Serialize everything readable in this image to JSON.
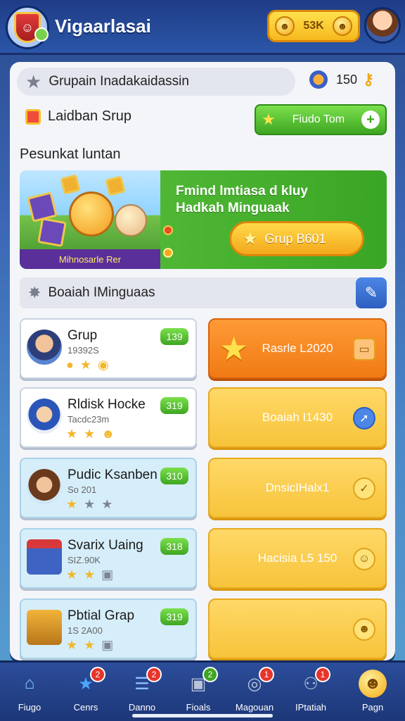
{
  "header": {
    "app_title": "Vigaarlasai",
    "currency_value": "53K"
  },
  "group": {
    "title": "Grupain Inadakaidassin",
    "rank_value": "150",
    "leaderboard_label": "Laidban Srup",
    "find_button_label": "Fiudo Tom"
  },
  "section_title": "Pesunkat luntan",
  "banner": {
    "caption": "Mihnosarle Rer",
    "text_line1": "Fmind lmtiasa d kluy",
    "text_line2": "Hadkah Minguaak",
    "button_label": "Grup B601"
  },
  "weekly": {
    "title": "Boaiah IMinguaas"
  },
  "cards": [
    {
      "name": "Grup",
      "sub": "19392S",
      "score": "139",
      "style": "white"
    },
    {
      "name": "Rldisk Hocke",
      "sub": "Tacdc23m",
      "score": "319",
      "style": "white"
    },
    {
      "name": "Pudic Ksanben",
      "sub": "So 201",
      "score": "310",
      "style": "blue"
    },
    {
      "name": "Svarix Uaing",
      "sub": "SIZ.90K",
      "score": "318",
      "style": "blue"
    },
    {
      "name": "Pbtial Grap",
      "sub": "1S 2A00",
      "score": "319",
      "style": "blue"
    }
  ],
  "rewards": [
    {
      "label": "Rasrle L2020",
      "style": "orange"
    },
    {
      "label": "Boaiah I1430",
      "style": "yellow"
    },
    {
      "label": "DnsicIHalx1",
      "style": "yellow"
    },
    {
      "label": "Hacisia L5 150",
      "style": "yellow"
    },
    {
      "label": "",
      "style": "yellow"
    }
  ],
  "nav": [
    {
      "label": "Fiugo",
      "badge": ""
    },
    {
      "label": "Cenrs",
      "badge": "2"
    },
    {
      "label": "Danno",
      "badge": "2"
    },
    {
      "label": "Fioals",
      "badge": "2"
    },
    {
      "label": "Magouan",
      "badge": "1"
    },
    {
      "label": "IPtatiah",
      "badge": "1"
    },
    {
      "label": "Pagn",
      "badge": ""
    }
  ],
  "colors": {
    "accent_green": "#3ea621",
    "accent_orange": "#f07a14",
    "accent_yellow": "#f7c43b",
    "nav_blue": "#1d3778"
  }
}
